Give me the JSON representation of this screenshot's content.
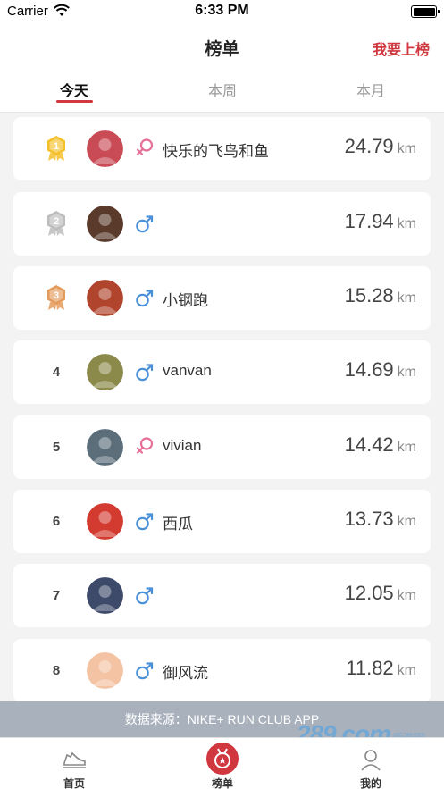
{
  "status_bar": {
    "carrier": "Carrier",
    "time": "6:33 PM"
  },
  "nav": {
    "title": "榜单",
    "right_action": "我要上榜"
  },
  "tabs": [
    {
      "label": "今天",
      "active": true
    },
    {
      "label": "本周",
      "active": false
    },
    {
      "label": "本月",
      "active": false
    }
  ],
  "colors": {
    "accent": "#d0373f",
    "male": "#4a90d9",
    "female": "#e66f98",
    "gold": "#f4c02a",
    "silver": "#bdbdbd",
    "bronze": "#e49a5a"
  },
  "unit": "km",
  "rankings": [
    {
      "rank": "1",
      "medal": "gold",
      "gender": "female",
      "name": "快乐的飞鸟和鱼",
      "distance": "24.79",
      "avatar": "#c94b56"
    },
    {
      "rank": "2",
      "medal": "silver",
      "gender": "male",
      "name": "",
      "distance": "17.94",
      "avatar": "#5a3a2a"
    },
    {
      "rank": "3",
      "medal": "bronze",
      "gender": "male",
      "name": "小钢跑",
      "distance": "15.28",
      "avatar": "#b0442c"
    },
    {
      "rank": "4",
      "medal": "",
      "gender": "male",
      "name": "vanvan",
      "distance": "14.69",
      "avatar": "#8c8a4a"
    },
    {
      "rank": "5",
      "medal": "",
      "gender": "female",
      "name": "vivian",
      "distance": "14.42",
      "avatar": "#5b6e7a"
    },
    {
      "rank": "6",
      "medal": "",
      "gender": "male",
      "name": "西瓜",
      "distance": "13.73",
      "avatar": "#d33b30"
    },
    {
      "rank": "7",
      "medal": "",
      "gender": "male",
      "name": "",
      "distance": "12.05",
      "avatar": "#3d4a6a"
    },
    {
      "rank": "8",
      "medal": "",
      "gender": "male",
      "name": "御风流",
      "distance": "11.82",
      "avatar": "#f4c3a3"
    }
  ],
  "source_banner": "数据来源：NIKE+ RUN CLUB APP",
  "tab_bar": [
    {
      "label": "首页",
      "icon": "shoe-icon"
    },
    {
      "label": "榜单",
      "icon": "medal-badge-icon",
      "active": true
    },
    {
      "label": "我的",
      "icon": "user-icon"
    }
  ],
  "watermark": {
    "main": "289.com",
    "sub": "手游网"
  }
}
